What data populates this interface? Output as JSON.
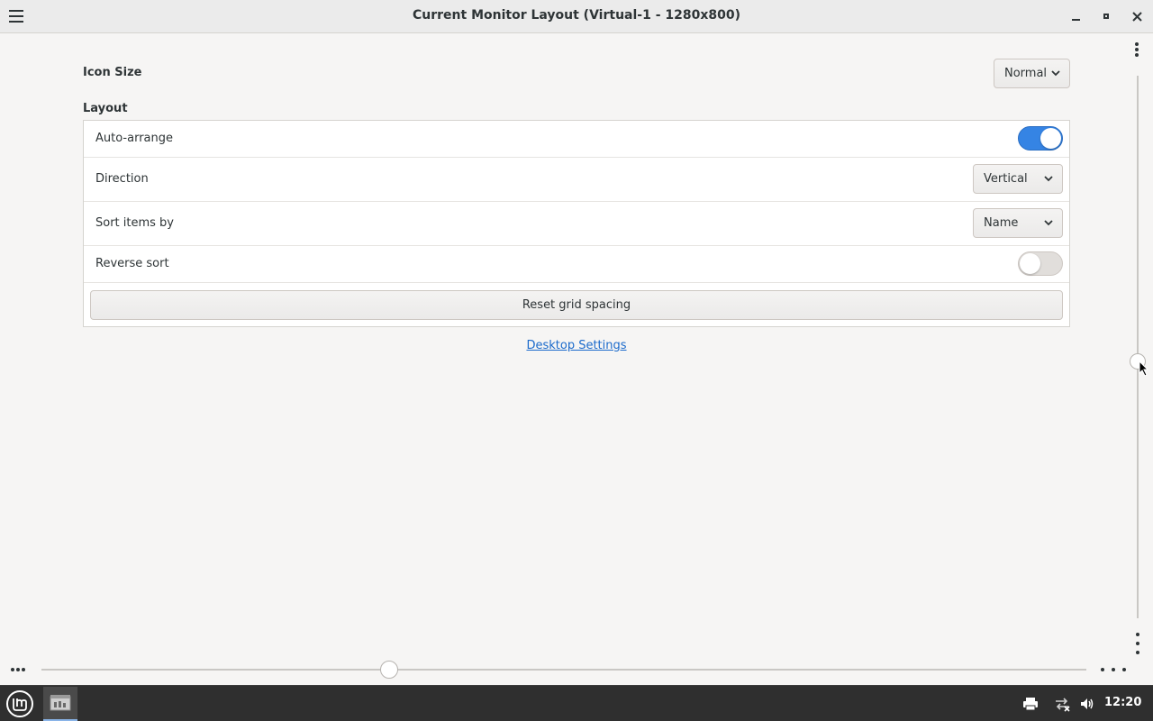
{
  "window": {
    "title": "Current Monitor Layout (Virtual-1 - 1280x800)"
  },
  "icon_size": {
    "label": "Icon Size",
    "value": "Normal"
  },
  "layout": {
    "heading": "Layout",
    "auto_arrange": {
      "label": "Auto-arrange",
      "enabled": true
    },
    "direction": {
      "label": "Direction",
      "value": "Vertical"
    },
    "sort_by": {
      "label": "Sort items by",
      "value": "Name"
    },
    "reverse_sort": {
      "label": "Reverse sort",
      "enabled": false
    },
    "reset_button": "Reset grid spacing"
  },
  "desktop_settings_link": "Desktop Settings",
  "taskbar": {
    "clock": "12:20",
    "icons": [
      "mint-menu-icon",
      "desktop-app-icon",
      "printer-icon",
      "network-icon",
      "volume-icon"
    ]
  },
  "colors": {
    "accent": "#3584e4",
    "link": "#1b6acb",
    "taskbar": "#2f2f2f"
  }
}
